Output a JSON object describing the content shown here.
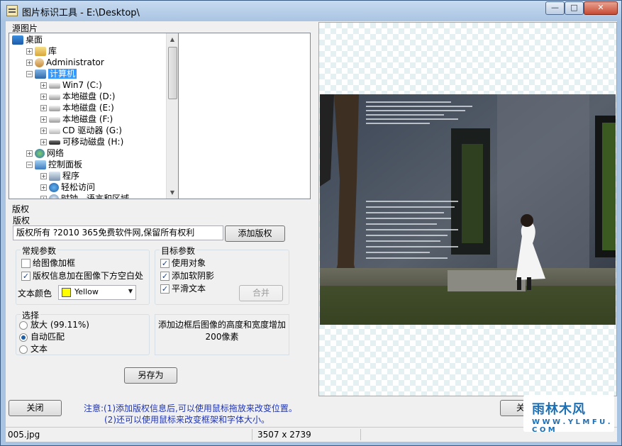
{
  "window": {
    "title": "图片标识工具 - E:\\Desktop\\",
    "minimize": "—",
    "maximize": "□",
    "close": "✕"
  },
  "source": {
    "label": "源图片",
    "tree": [
      {
        "label": "桌面",
        "icon": "desktop-icon",
        "expander": ""
      },
      {
        "label": "库",
        "icon": "library-icon",
        "expander": "+"
      },
      {
        "label": "Administrator",
        "icon": "user-icon",
        "expander": "+"
      },
      {
        "label": "计算机",
        "icon": "computer-icon",
        "expander": "−",
        "selected": true
      },
      {
        "label": "Win7 (C:)",
        "icon": "drive-icon",
        "expander": "+"
      },
      {
        "label": "本地磁盘 (D:)",
        "icon": "drive-icon",
        "expander": "+"
      },
      {
        "label": "本地磁盘 (E:)",
        "icon": "drive-icon",
        "expander": "+"
      },
      {
        "label": "本地磁盘 (F:)",
        "icon": "drive-icon",
        "expander": "+"
      },
      {
        "label": "CD 驱动器 (G:)",
        "icon": "cd-drive-icon",
        "expander": "+"
      },
      {
        "label": "可移动磁盘 (H:)",
        "icon": "usb-drive-icon",
        "expander": "+"
      },
      {
        "label": "网络",
        "icon": "network-icon",
        "expander": "+"
      },
      {
        "label": "控制面板",
        "icon": "control-panel-icon",
        "expander": "−"
      },
      {
        "label": "程序",
        "icon": "programs-icon",
        "expander": "+"
      },
      {
        "label": "轻松访问",
        "icon": "accessibility-icon",
        "expander": "+"
      },
      {
        "label": "时钟、语言和区域",
        "icon": "clock-icon",
        "expander": "+"
      }
    ]
  },
  "copyright": {
    "section_label": "版权",
    "field_label": "版权",
    "value": "版权所有 ?2010 365免费软件网,保留所有权利",
    "add_button": "添加版权"
  },
  "general": {
    "title": "常规参数",
    "add_frame": "给图像加框",
    "add_frame_checked": false,
    "info_below": "版权信息加在图像下方空白处",
    "info_below_checked": true,
    "text_color_label": "文本颜色",
    "text_color": "Yellow",
    "text_color_hex": "#ffff00"
  },
  "target": {
    "title": "目标参数",
    "use_object": "使用对象",
    "use_object_checked": true,
    "soft_shadow": "添加软阴影",
    "soft_shadow_checked": true,
    "smooth_text": "平滑文本",
    "smooth_text_checked": true,
    "merge_button": "合并"
  },
  "select": {
    "title": "选择",
    "options": [
      {
        "label": "放大 (99.11%)",
        "checked": false
      },
      {
        "label": "自动匹配",
        "checked": true
      },
      {
        "label": "文本",
        "checked": false
      }
    ]
  },
  "border_note": "添加边框后图像的高度和宽度增加200像素",
  "save_as_button": "另存为",
  "close_button": "关闭",
  "right_button_partial": "关",
  "notes": {
    "line1": "注意:(1)添加版权信息后,可以使用鼠标拖放来改变位置。",
    "line2": "(2)还可以使用鼠标来改变框架和字体大小。"
  },
  "status": {
    "filename": "005.jpg",
    "dimensions": "3507 x 2739"
  },
  "watermark": {
    "main": "雨林木风",
    "sub": "W W W . Y L M F U . C O M"
  }
}
